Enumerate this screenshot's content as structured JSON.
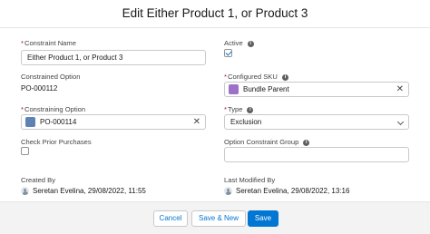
{
  "modal": {
    "title": "Edit Either Product 1, or Product 3"
  },
  "fields": {
    "constraint_name": {
      "label": "Constraint Name",
      "required_mark": "*",
      "value": "Either Product 1, or Product 3"
    },
    "active": {
      "label": "Active",
      "checked": true
    },
    "constrained_option": {
      "label": "Constrained Option",
      "value": "PO-000112"
    },
    "configured_sku": {
      "label": "Configured SKU",
      "required_mark": "*",
      "value": "Bundle Parent",
      "icon": "product-icon",
      "icon_color": "#9e71c8"
    },
    "constraining_option": {
      "label": "Constraining Option",
      "required_mark": "*",
      "value": "PO-000114",
      "icon": "option-icon",
      "icon_color": "#5f82b5"
    },
    "type": {
      "label": "Type",
      "required_mark": "*",
      "value": "Exclusion"
    },
    "check_prior_purchases": {
      "label": "Check Prior Purchases",
      "checked": false
    },
    "option_constraint_group": {
      "label": "Option Constraint Group",
      "value": ""
    },
    "created_by": {
      "label": "Created By",
      "value": "Seretan Evelina, 29/08/2022, 11:55"
    },
    "last_modified_by": {
      "label": "Last Modified By",
      "value": "Seretan Evelina, 29/08/2022, 13:16"
    }
  },
  "footer": {
    "cancel_label": "Cancel",
    "save_new_label": "Save & New",
    "save_label": "Save"
  },
  "colors": {
    "brand": "#0176d3",
    "required": "#ba0517"
  }
}
